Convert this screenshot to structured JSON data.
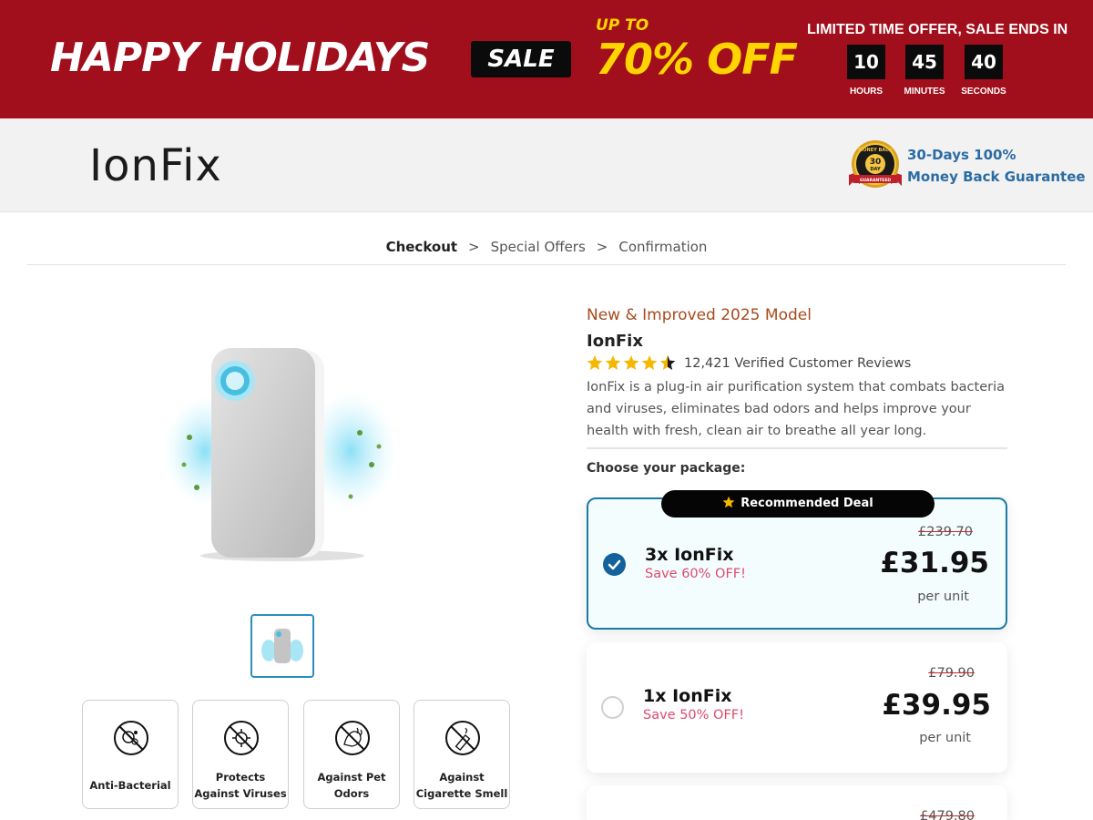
{
  "banner": {
    "headline": "HAPPY HOLIDAYS",
    "sale_tag": "SALE",
    "discount_prefix": "UP TO",
    "discount": "70% OFF",
    "limited_text": "LIMITED TIME OFFER, SALE ENDS IN",
    "timer": [
      {
        "value": "10",
        "label": "HOURS"
      },
      {
        "value": "45",
        "label": "MINUTES"
      },
      {
        "value": "40",
        "label": "SECONDS"
      }
    ],
    "background_color": "#a10e1c",
    "accent_color": "#ffd400"
  },
  "header": {
    "logo": "IonFix",
    "badge_text": [
      "MONEY BACK",
      "30",
      "DAY",
      "GUARANTEED"
    ],
    "guarantee_line1": "30-Days 100%",
    "guarantee_line2": "Money Back Guarantee"
  },
  "breadcrumb": {
    "steps": [
      "Checkout",
      "Special Offers",
      "Confirmation"
    ],
    "separator": ">",
    "active": "Checkout"
  },
  "product": {
    "model_tag": "New & Improved 2025 Model",
    "name": "IonFix",
    "rating": 4.5,
    "reviews": "12,421 Verified Customer Reviews",
    "description": "IonFix is a plug-in air purification system that combats bacteria and viruses, eliminates bad odors and helps improve your health with fresh, clean air to breathe all year long.",
    "image_icon": "air-purifier-image",
    "features": [
      {
        "icon": "anti-bacterial-icon",
        "line1": "Anti-Bacterial",
        "line2": ""
      },
      {
        "icon": "virus-icon",
        "line1": "Protects",
        "line2": "Against Viruses"
      },
      {
        "icon": "pet-odor-icon",
        "line1": "Against Pet",
        "line2": "Odors"
      },
      {
        "icon": "cigarette-icon",
        "line1": "Against",
        "line2": "Cigarette Smell"
      }
    ]
  },
  "packages": {
    "heading": "Choose your package:",
    "recommended_label": "Recommended Deal",
    "items": [
      {
        "title": "3x IonFix",
        "save": "Save 60% OFF!",
        "old_price": "£239.70",
        "price": "£31.95",
        "unit": "per unit",
        "selected": true
      },
      {
        "title": "1x IonFix",
        "save": "Save 50% OFF!",
        "old_price": "£79.90",
        "price": "£39.95",
        "unit": "per unit",
        "selected": false
      },
      {
        "old_price": "£479.80"
      }
    ],
    "selected_color": "#1b7aa6",
    "save_color": "#de4a6e"
  }
}
